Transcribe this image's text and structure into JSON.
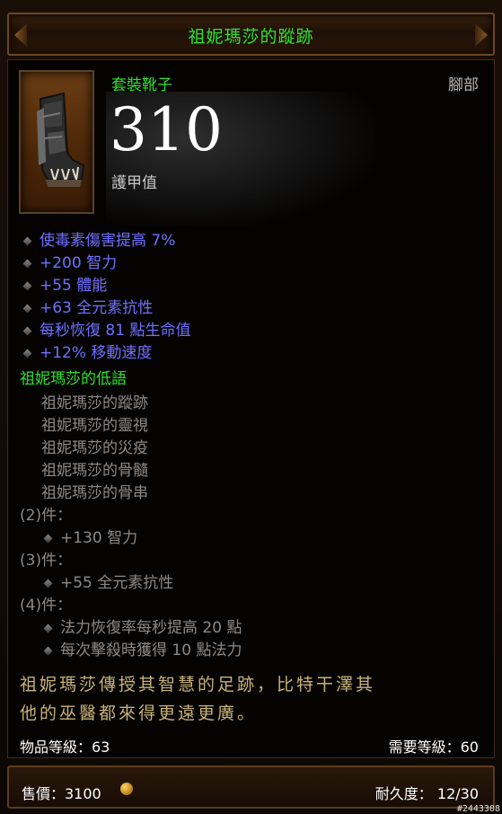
{
  "title": "祖妮瑪莎的蹤跡",
  "item_type": "套裝靴子",
  "slot": "腳部",
  "armor": {
    "value": "310",
    "label": "護甲值"
  },
  "primary_stats": [
    "使毒素傷害提高 7%",
    "+200 智力",
    "+55 體能",
    "+63 全元素抗性",
    "每秒恢復 81 點生命值",
    "+12% 移動速度"
  ],
  "set": {
    "name": "祖妮瑪莎的低語",
    "pieces": [
      "祖妮瑪莎的蹤跡",
      "祖妮瑪莎的靈視",
      "祖妮瑪莎的災疫",
      "祖妮瑪莎的骨髓",
      "祖妮瑪莎的骨串"
    ],
    "bonuses": [
      {
        "label": "(2)件：",
        "effects": [
          "+130 智力"
        ]
      },
      {
        "label": "(3)件：",
        "effects": [
          "+55 全元素抗性"
        ]
      },
      {
        "label": "(4)件：",
        "effects": [
          "法力恢復率每秒提高 20 點",
          "每次擊殺時獲得 10 點法力"
        ]
      }
    ]
  },
  "flavor": [
    "祖妮瑪莎傳授其智慧的足跡，比特干澤其",
    "他的巫醫都來得更遠更廣。"
  ],
  "item_level": "物品等級：63",
  "required_level": "需要等級：60",
  "price": {
    "label": "售價：3100",
    "icon": "gold-coin-icon"
  },
  "durability": "耐久度：  12/30",
  "watermark": "#2443308"
}
